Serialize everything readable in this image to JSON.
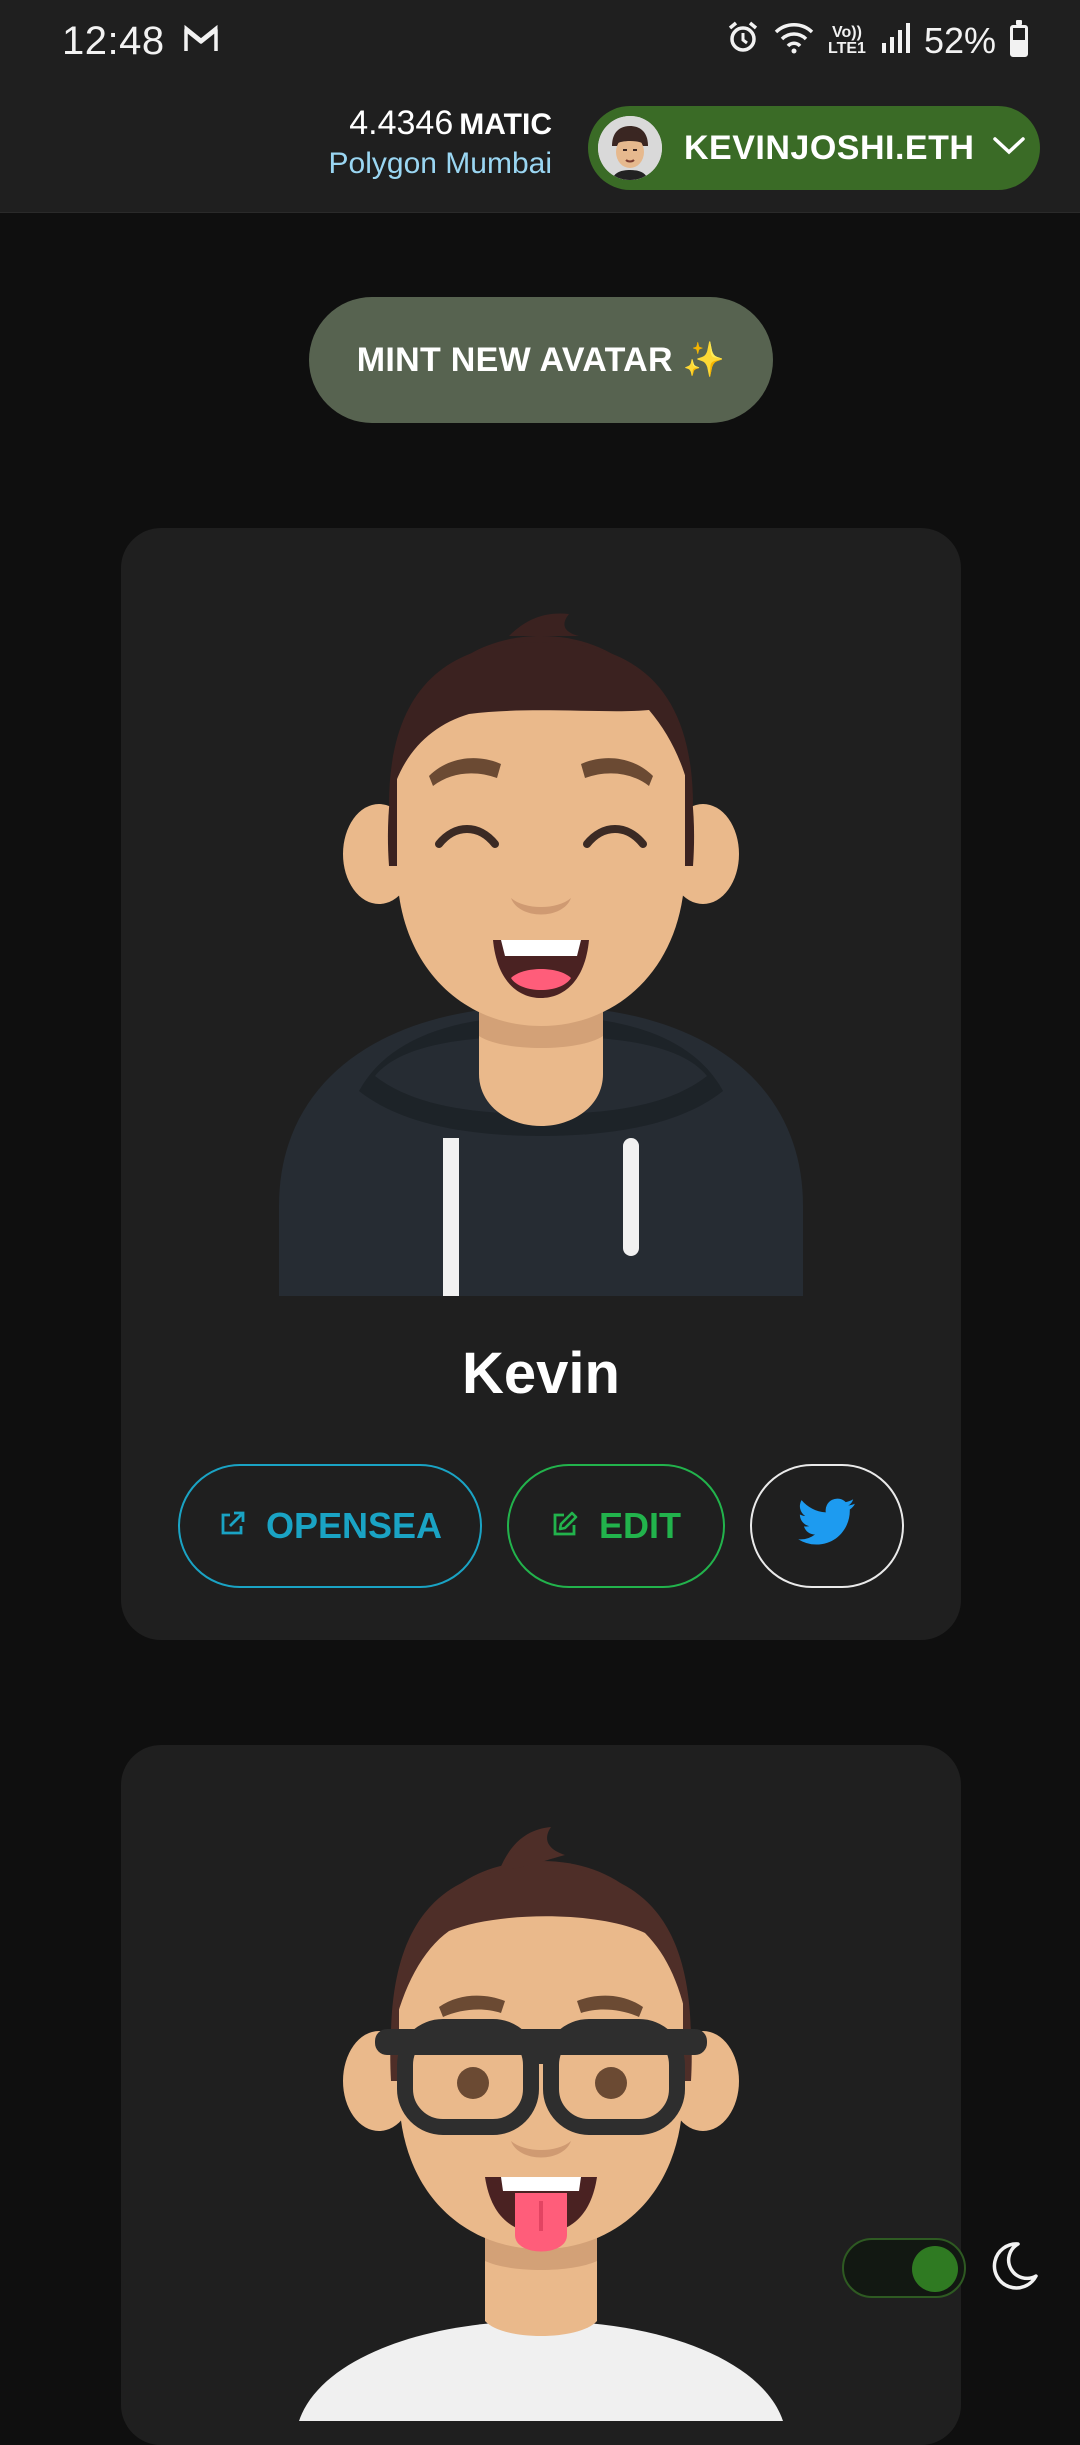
{
  "status_bar": {
    "time": "12:48",
    "volte_top": "Vo))",
    "volte_bottom": "LTE1",
    "battery": "52%"
  },
  "header": {
    "balance_amount": "4.4346",
    "balance_unit": "MATIC",
    "network": "Polygon Mumbai",
    "account_name": "KEVINJOSHI.ETH"
  },
  "mint_button": {
    "label": "MINT NEW AVATAR ✨"
  },
  "cards": [
    {
      "name": "Kevin",
      "opensea_label": "OPENSEA",
      "edit_label": "EDIT"
    }
  ],
  "colors": {
    "account_green": "#3a6b26",
    "mint_bg": "#576350",
    "opensea_blue": "#1aa3c4",
    "edit_green": "#22b34c",
    "twitter_blue": "#1d9bf0"
  },
  "icons": {
    "gmail": "gmail-icon",
    "alarm": "alarm-icon",
    "wifi": "wifi-icon",
    "signal": "signal-icon",
    "battery": "battery-icon",
    "chevron": "chevron-down-icon",
    "external": "external-link-icon",
    "edit": "pencil-icon",
    "twitter": "twitter-bird-icon",
    "moon": "moon-icon"
  }
}
